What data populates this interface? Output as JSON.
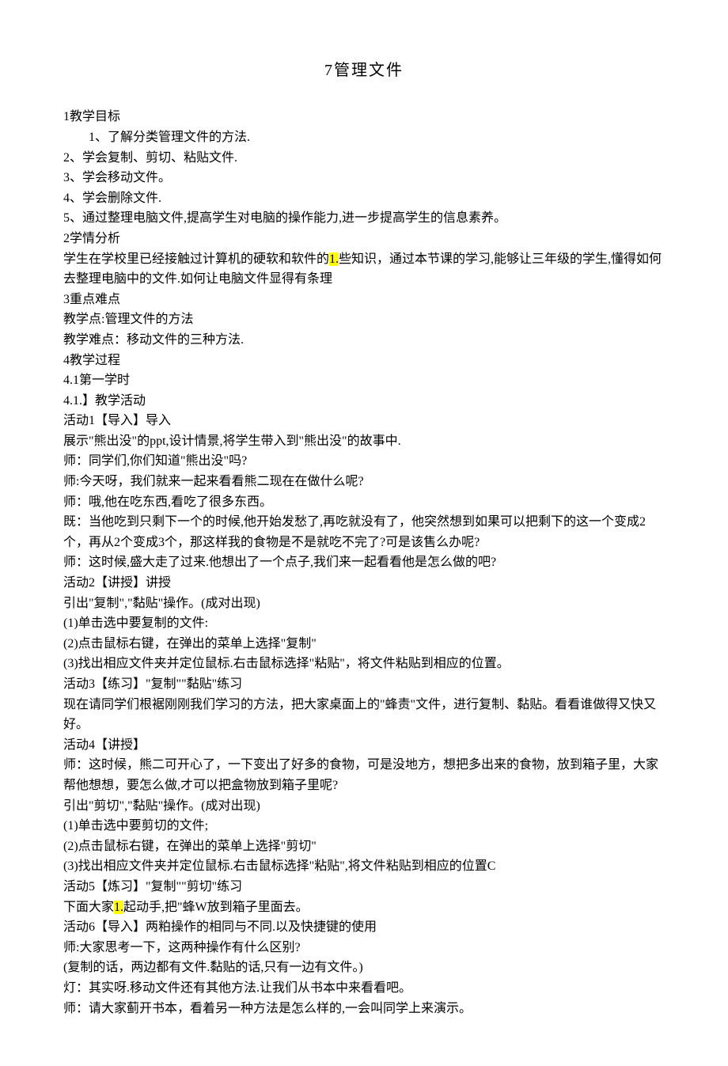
{
  "title": "7管理文件",
  "lines": [
    {
      "text": "1教学目标",
      "indent": false
    },
    {
      "text": "1、了解分类管理文件的方法.",
      "indent": true
    },
    {
      "text": "2、学会复制、剪切、粘贴文件.",
      "indent": false
    },
    {
      "text": "3、学会移动文件。",
      "indent": false
    },
    {
      "text": "4、学会删除文件.",
      "indent": false
    },
    {
      "text": "5、通过整理电脑文件,提高学生对电脑的操作能力,进一步提高学生的信息素养。",
      "indent": false
    },
    {
      "text": "2学情分析",
      "indent": false
    },
    {
      "text": "学生在学校里已经接触过计算机的硬软和软件的",
      "indent": false,
      "append": [
        {
          "text": "1.",
          "highlight": true
        },
        {
          "text": "些知识，通过本节课的学习,能够让三年级的学生,懂得如何去整理电脑中的文件.如何让电脑文件显得有条理"
        }
      ]
    },
    {
      "text": "3重点难点",
      "indent": false
    },
    {
      "text": "教学点:管理文件的方法",
      "indent": false
    },
    {
      "text": "教学难点：移动文件的三种方法.",
      "indent": false
    },
    {
      "text": "4教学过程",
      "indent": false
    },
    {
      "text": "4.1第一学时",
      "indent": false
    },
    {
      "text": "4.1.】教学活动",
      "indent": false
    },
    {
      "text": "活动1【导入】导入",
      "indent": false
    },
    {
      "text": "展示\"熊出没\"的ppt,设计情景,将学生带入到\"熊出没\"的故事中.",
      "indent": false
    },
    {
      "text": "师：同学们,你们知道\"熊出没\"吗?",
      "indent": false
    },
    {
      "text": "师:今天呀，我们就来一起来看看熊二现在在做什么呢?",
      "indent": false
    },
    {
      "text": "师：哦,他在吃东西,看吃了很多东西。",
      "indent": false
    },
    {
      "text": "既：当他吃到只剩下一个的时候,他开始发愁了,再吃就没有了，他突然想到如果可以把剩下的这一个变成2个，再从2个变成3个，那这样我的食物是不是就吃不完了?可是该售么办呢?",
      "indent": false
    },
    {
      "text": "师：这时候,盛大走了过来.他想出了一个点子,我们来一起看看他是怎么做的吧?",
      "indent": false
    },
    {
      "text": "活动2【讲授】讲授",
      "indent": false
    },
    {
      "text": "引出\"复制\",\"黏贴\"操作。(成对出现)",
      "indent": false
    },
    {
      "text": "(1)单击选中要复制的文件:",
      "indent": false
    },
    {
      "text": "(2)点击鼠标右键，在弹出的菜单上选择\"复制\"",
      "indent": false
    },
    {
      "text": "(3)找出相应文件夹并定位鼠标.右击鼠标选择\"粘贴\"，将文件粘贴到相应的位置。",
      "indent": false
    },
    {
      "text": "活动3【练习】\"复制\"\"黏贴\"练习",
      "indent": false
    },
    {
      "text": "现在请同学们根裾刚刚我们学习的方法，把大家桌面上的\"蜂责\"文件，进行复制、黏贴。看看谁做得又快又好。",
      "indent": false
    },
    {
      "text": "活动4【讲授】",
      "indent": false
    },
    {
      "text": "师：这时候，熊二可开心了，一下变出了好多的食物，可是没地方，想把多出来的食物，放到箱子里，大家帮他想想，要怎么做,才可以把盒物放到箱子里呢?",
      "indent": false
    },
    {
      "text": "引出\"剪切\",\"黏贴\"操作。(成对出现)",
      "indent": false
    },
    {
      "text": "(1)单击选中要剪切的文件;",
      "indent": false
    },
    {
      "text": "(2)点击鼠标右键，在弹出的菜单上选择\"剪切\"",
      "indent": false
    },
    {
      "text": "(3)找出相应文件夹并定位鼠标.右击鼠标选择\"粘贴\",将文件粘贴到相应的位置C",
      "indent": false
    },
    {
      "text": "活动5【炼习】\"复制\"\"剪切\"练习",
      "indent": false
    },
    {
      "text": "下面大家",
      "indent": false,
      "append": [
        {
          "text": "1.",
          "highlight": true
        },
        {
          "text": "起动手,把\"蜂W放到箱子里面去。"
        }
      ]
    },
    {
      "text": "活动6【导入】两粕操作的相同与不同.以及快捷键的使用",
      "indent": false
    },
    {
      "text": "师:大家思考一下，这两种操作有什么区别?",
      "indent": false
    },
    {
      "text": "(复制的话，两边都有文件.黏贴的话,只有一边有文件。)",
      "indent": false
    },
    {
      "text": "灯：其实呀.移动文件还有其他方法.让我们从书本中来看看吧。",
      "indent": false
    },
    {
      "text": "师：请大家蓟开书本，看着另一种方法是怎么样的,一会叫同学上来演示。",
      "indent": false
    }
  ]
}
